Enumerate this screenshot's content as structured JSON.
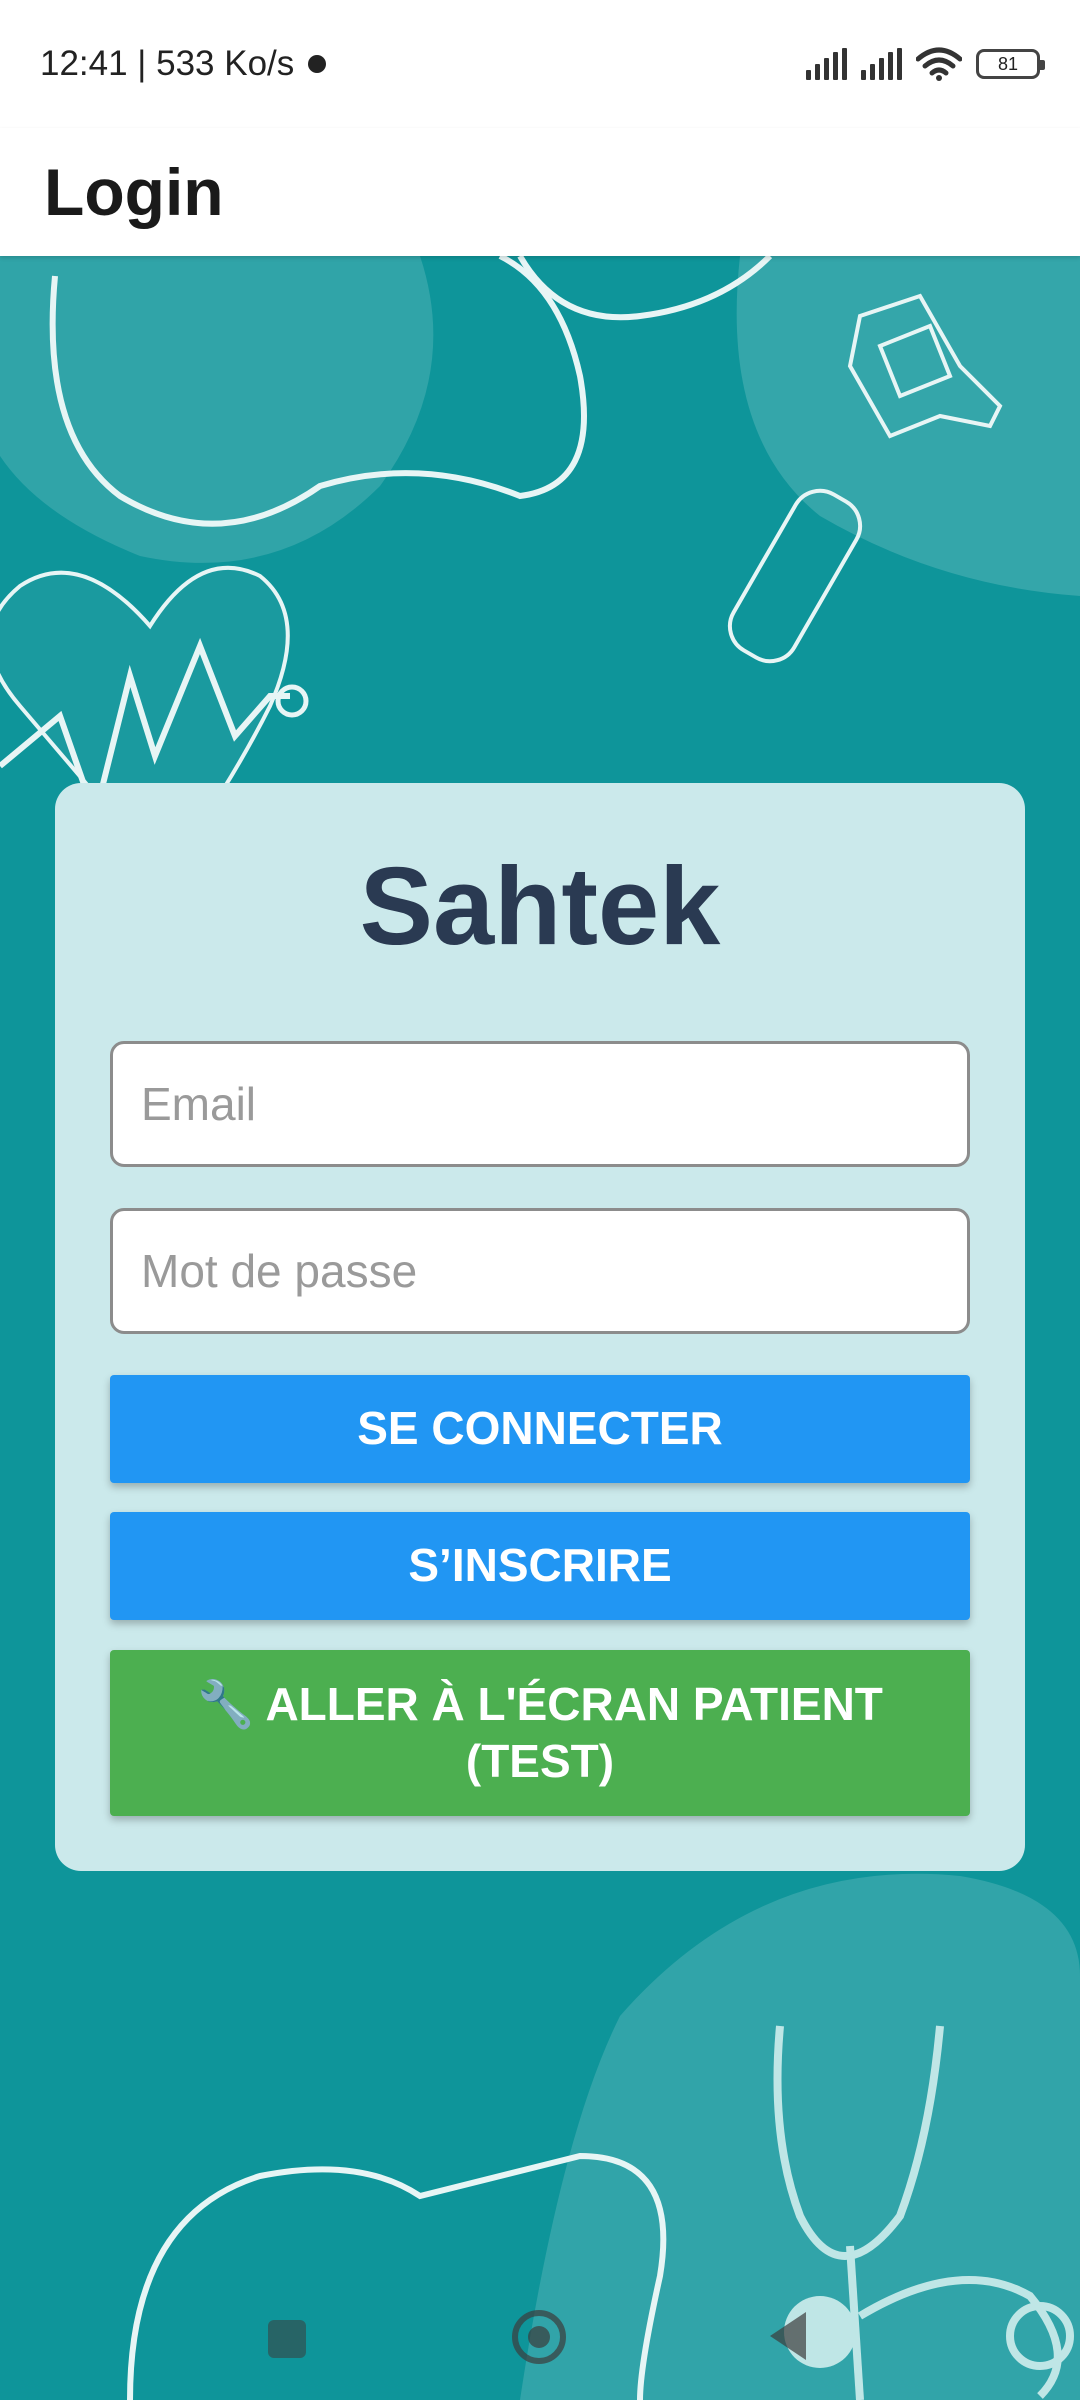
{
  "status_bar": {
    "time_speed": "12:41 | 533 Ko/s",
    "battery": "81"
  },
  "app_bar": {
    "title": "Login"
  },
  "login_card": {
    "app_name": "Sahtek",
    "email_placeholder": "Email",
    "password_placeholder": "Mot de passe",
    "login_button": "SE CONNECTER",
    "register_button": "S’INSCRIRE",
    "patient_test_button": "🔧 ALLER À L'ÉCRAN PATIENT (TEST)"
  },
  "colors": {
    "background": "#0e959a",
    "card": "#cbe9eb",
    "title": "#2a3a52",
    "primary_button": "#2196f3",
    "test_button": "#4caf50"
  },
  "icons": [
    "signal-icon",
    "wifi-icon",
    "battery-icon",
    "recents-icon",
    "home-icon",
    "back-icon"
  ]
}
